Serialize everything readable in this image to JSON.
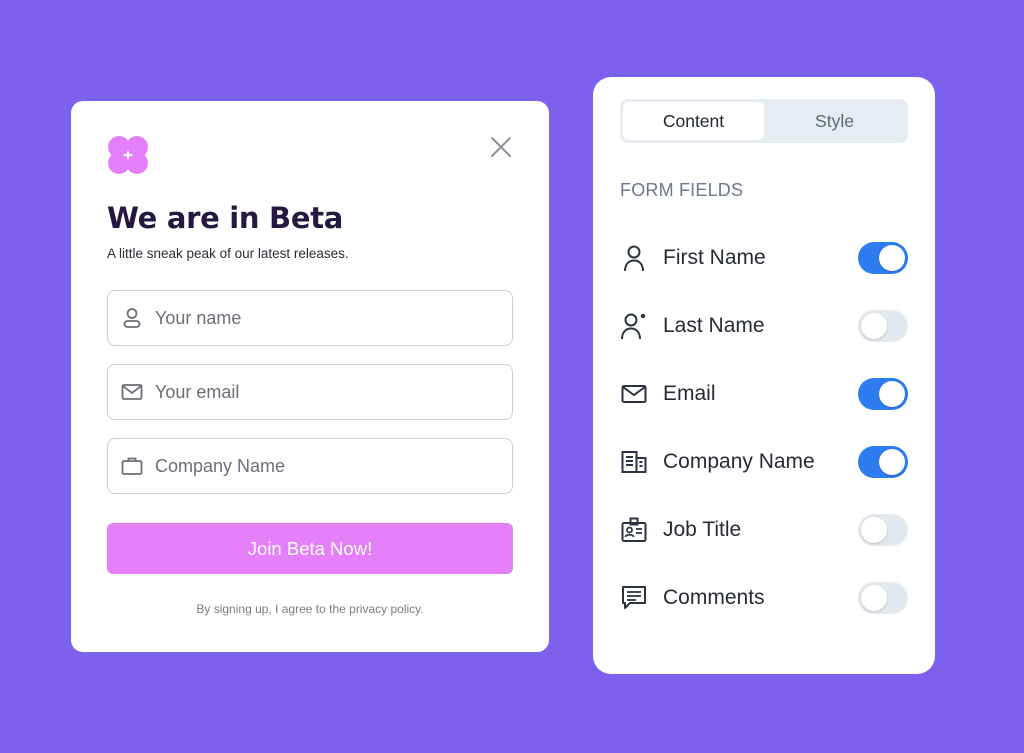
{
  "modal": {
    "logo_icon": "flower-sparkle-logo",
    "close_icon": "close-icon",
    "title": "We are in Beta",
    "subtitle": "A little sneak peak of our latest releases.",
    "fields": [
      {
        "icon": "user-icon",
        "placeholder": "Your name"
      },
      {
        "icon": "mail-icon",
        "placeholder": "Your email"
      },
      {
        "icon": "briefcase-icon",
        "placeholder": "Company Name"
      }
    ],
    "submit_label": "Join Beta Now!",
    "privacy_text": "By signing up, I agree to the privacy policy.",
    "colors": {
      "accent": "#e47ef9",
      "title": "#25193f",
      "logo": "#e47ef9"
    }
  },
  "panel": {
    "tabs": [
      {
        "label": "Content",
        "active": true
      },
      {
        "label": "Style",
        "active": false
      }
    ],
    "section_label": "FORM FIELDS",
    "fields": [
      {
        "icon": "user-icon",
        "label": "First Name",
        "enabled": true
      },
      {
        "icon": "user-plus-icon",
        "label": "Last Name",
        "enabled": false
      },
      {
        "icon": "mail-icon",
        "label": "Email",
        "enabled": true
      },
      {
        "icon": "building-icon",
        "label": "Company Name",
        "enabled": true
      },
      {
        "icon": "id-badge-icon",
        "label": "Job Title",
        "enabled": false
      },
      {
        "icon": "comment-icon",
        "label": "Comments",
        "enabled": false
      }
    ],
    "colors": {
      "toggle_on": "#2d7df0",
      "toggle_off": "#e3e8ef"
    }
  },
  "background_color": "#7b61ec"
}
